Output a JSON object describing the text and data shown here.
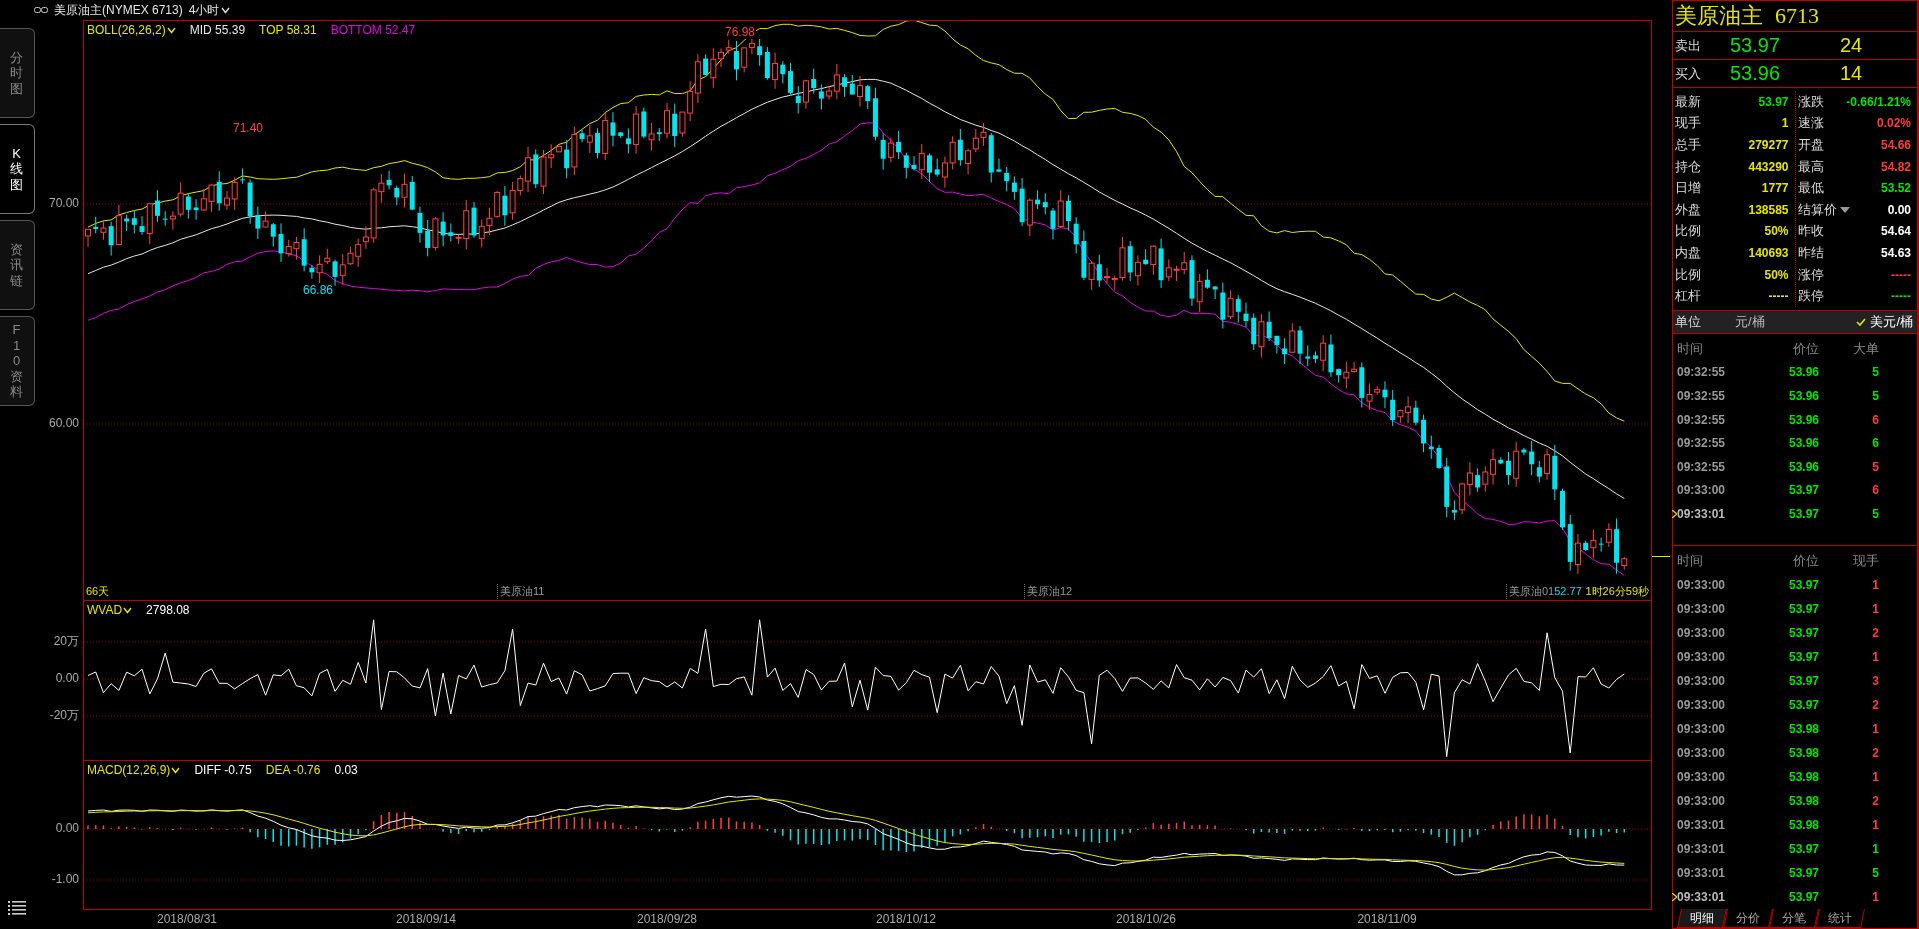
{
  "top_bar": {
    "title": "美原油主(NYMEX 6713)",
    "period": "4小时"
  },
  "side_tabs": [
    {
      "label": "分时图",
      "selected": false
    },
    {
      "label": "K线图",
      "selected": true
    },
    {
      "label": "资讯链",
      "selected": false
    },
    {
      "label": "F10资料",
      "selected": false
    }
  ],
  "price_panel": {
    "indicator": "BOLL(26,26,2)",
    "legend": [
      {
        "label": "MID 55.39",
        "color": "#e6e6e6"
      },
      {
        "label": "TOP 58.31",
        "color": "#e6e600"
      },
      {
        "label": "BOTTOM 52.47",
        "color": "#e600e6"
      }
    ],
    "y_ticks": [
      "70.00",
      "60.00"
    ],
    "annotations": [
      {
        "text": "71.40",
        "kind": "high"
      },
      {
        "text": "66.86",
        "kind": "low"
      },
      {
        "text": "76.98",
        "kind": "high"
      }
    ],
    "span": "66天",
    "contracts": [
      "美原油11",
      "美原油12",
      "美原油01"
    ],
    "last_low": "52.77",
    "countdown": "1时26分59秒"
  },
  "wvad_panel": {
    "indicator": "WVAD",
    "value": "2798.08",
    "y_ticks": [
      "20万",
      "0.00",
      "-20万"
    ]
  },
  "macd_panel": {
    "indicator": "MACD(12,26,9)",
    "legend": [
      {
        "label": "DIFF -0.75",
        "color": "#ffffff"
      },
      {
        "label": "DEA -0.76",
        "color": "#e6e600"
      },
      {
        "label": "0.03",
        "color": "#ffffff"
      }
    ],
    "y_ticks": [
      "0.00",
      "-1.00"
    ]
  },
  "x_axis": {
    "dates": [
      "2018/08/31",
      "2018/09/14",
      "2018/09/28",
      "2018/10/12",
      "2018/10/26",
      "2018/11/09"
    ]
  },
  "quote": {
    "name": "美原油主",
    "code": "6713",
    "orders": [
      {
        "label": "卖出",
        "price": "53.97",
        "volume": "24"
      },
      {
        "label": "买入",
        "price": "53.96",
        "volume": "14"
      }
    ],
    "stats_left": [
      {
        "label": "最新",
        "value": "53.97",
        "color": "#00e600"
      },
      {
        "label": "现手",
        "value": "1",
        "color": "#e6e600"
      },
      {
        "label": "总手",
        "value": "279277",
        "color": "#e6e600"
      },
      {
        "label": "持仓",
        "value": "443290",
        "color": "#e6e600"
      },
      {
        "label": "日增",
        "value": "1777",
        "color": "#e6e600"
      },
      {
        "label": "外盘",
        "value": "138585",
        "color": "#e6e600"
      },
      {
        "label": "比例",
        "value": "50%",
        "color": "#e6e600"
      },
      {
        "label": "内盘",
        "value": "140693",
        "color": "#e6e600"
      },
      {
        "label": "比例",
        "value": "50%",
        "color": "#e6e600"
      },
      {
        "label": "杠杆",
        "value": "-----",
        "color": "#e6e600"
      }
    ],
    "stats_right": [
      {
        "label": "涨跌",
        "value": "-0.66/1.21%",
        "color": "#00e600",
        "kind": "plain"
      },
      {
        "label": "速涨",
        "value": "0.02%",
        "color": "#ff3c3c",
        "kind": "plain"
      },
      {
        "label": "开盘",
        "value": "54.66",
        "color": "#ff3c3c",
        "kind": "plain"
      },
      {
        "label": "最高",
        "value": "54.82",
        "color": "#ff3c3c",
        "kind": "plain"
      },
      {
        "label": "最低",
        "value": "53.52",
        "color": "#00e600",
        "kind": "plain"
      },
      {
        "label": "结算价",
        "value": "0.00",
        "color": "#ffffff",
        "kind": "dropdown"
      },
      {
        "label": "昨收",
        "value": "54.64",
        "color": "#ffffff",
        "kind": "plain"
      },
      {
        "label": "昨结",
        "value": "54.63",
        "color": "#ffffff",
        "kind": "plain"
      },
      {
        "label": "涨停",
        "value": "-----",
        "color": "#ff3c3c",
        "kind": "plain"
      },
      {
        "label": "跌停",
        "value": "-----",
        "color": "#00e600",
        "kind": "plain"
      }
    ],
    "unit_label": "单位",
    "units": [
      {
        "label": "元/桶",
        "selected": false
      },
      {
        "label": "美元/桶",
        "selected": true
      }
    ]
  },
  "big_orders": {
    "columns": [
      "时间",
      "价位",
      "大单"
    ],
    "rows": [
      {
        "time": "09:32:55",
        "price": "53.96",
        "size": "5",
        "color": "#00e600",
        "current": false
      },
      {
        "time": "09:32:55",
        "price": "53.96",
        "size": "5",
        "color": "#00e600",
        "current": false
      },
      {
        "time": "09:32:55",
        "price": "53.96",
        "size": "6",
        "color": "#ff3c3c",
        "current": false
      },
      {
        "time": "09:32:55",
        "price": "53.96",
        "size": "6",
        "color": "#00e600",
        "current": false
      },
      {
        "time": "09:32:55",
        "price": "53.96",
        "size": "5",
        "color": "#ff3c3c",
        "current": false
      },
      {
        "time": "09:33:00",
        "price": "53.97",
        "size": "6",
        "color": "#ff3c3c",
        "current": false
      },
      {
        "time": "09:33:01",
        "price": "53.97",
        "size": "5",
        "color": "#00e600",
        "current": true
      }
    ]
  },
  "trades": {
    "columns": [
      "时间",
      "价位",
      "现手"
    ],
    "rows": [
      {
        "time": "09:33:00",
        "price": "53.97",
        "size": "1",
        "color": "#ff3c3c",
        "current": false
      },
      {
        "time": "09:33:00",
        "price": "53.97",
        "size": "1",
        "color": "#ff3c3c",
        "current": false
      },
      {
        "time": "09:33:00",
        "price": "53.97",
        "size": "2",
        "color": "#ff3c3c",
        "current": false
      },
      {
        "time": "09:33:00",
        "price": "53.97",
        "size": "1",
        "color": "#ff3c3c",
        "current": false
      },
      {
        "time": "09:33:00",
        "price": "53.97",
        "size": "3",
        "color": "#ff3c3c",
        "current": false
      },
      {
        "time": "09:33:00",
        "price": "53.97",
        "size": "2",
        "color": "#ff3c3c",
        "current": false
      },
      {
        "time": "09:33:00",
        "price": "53.98",
        "size": "1",
        "color": "#ff3c3c",
        "current": false
      },
      {
        "time": "09:33:00",
        "price": "53.98",
        "size": "2",
        "color": "#ff3c3c",
        "current": false
      },
      {
        "time": "09:33:00",
        "price": "53.98",
        "size": "1",
        "color": "#ff3c3c",
        "current": false
      },
      {
        "time": "09:33:00",
        "price": "53.98",
        "size": "2",
        "color": "#ff3c3c",
        "current": false
      },
      {
        "time": "09:33:01",
        "price": "53.98",
        "size": "1",
        "color": "#ff3c3c",
        "current": false
      },
      {
        "time": "09:33:01",
        "price": "53.97",
        "size": "1",
        "color": "#00e600",
        "current": false
      },
      {
        "time": "09:33:01",
        "price": "53.97",
        "size": "5",
        "color": "#00e600",
        "current": false
      },
      {
        "time": "09:33:01",
        "price": "53.97",
        "size": "1",
        "color": "#ff3c3c",
        "current": true
      }
    ]
  },
  "bottom_tabs": [
    {
      "label": "明细",
      "selected": true
    },
    {
      "label": "分价",
      "selected": false
    },
    {
      "label": "分笔",
      "selected": false
    },
    {
      "label": "统计",
      "selected": false
    }
  ]
}
